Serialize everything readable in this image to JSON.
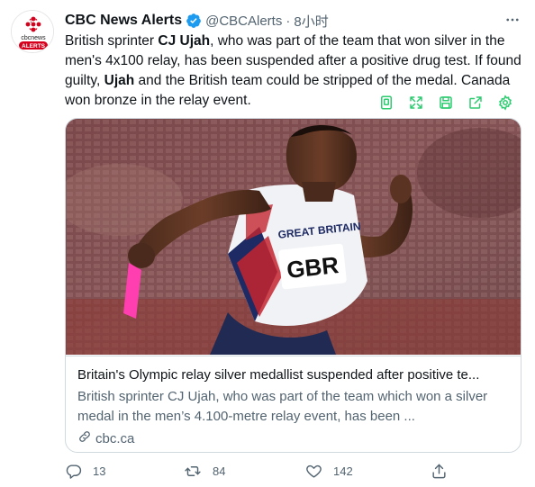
{
  "account": {
    "name": "CBC News Alerts",
    "handle": "@CBCAlerts",
    "separator": "·",
    "time": "8小时",
    "avatar_label": "cbcnews",
    "avatar_sub": "ALERTS",
    "avatar_icon": "cbc-gem-logo",
    "verified_icon": "verified-badge-icon"
  },
  "tweet": {
    "segments": [
      {
        "text": "British sprinter ",
        "bold": false
      },
      {
        "text": "CJ Ujah",
        "bold": true
      },
      {
        "text": ", who was part of the team that won silver in the men's 4x100 relay, has been suspended after a positive drug test. If found guilty, ",
        "bold": false
      },
      {
        "text": "Ujah",
        "bold": true
      },
      {
        "text": " and the British team could be stripped of the medal. Canada won bronze in the relay event.",
        "bold": false
      }
    ]
  },
  "extension_toolbar": {
    "buttons": [
      "copy-icon",
      "expand-icon",
      "save-icon",
      "share-icon",
      "settings-icon"
    ],
    "accent": "#2ecc71"
  },
  "card": {
    "title": "Britain's Olympic relay silver medallist suspended after positive te...",
    "description": "British sprinter CJ Ujah, who was part of the team which won a silver medal in the men’s 4.100-metre relay event, has been ...",
    "domain": "cbc.ca",
    "image": {
      "bib_text": "GBR",
      "vest_text": "GREAT BRITAIN"
    }
  },
  "actions": {
    "reply_count": "13",
    "retweet_count": "84",
    "like_count": "142"
  },
  "colors": {
    "text": "#0f1419",
    "muted": "#536471",
    "verified": "#1d9bf0",
    "border": "#cfd9de",
    "cbc_red": "#d6001c"
  }
}
